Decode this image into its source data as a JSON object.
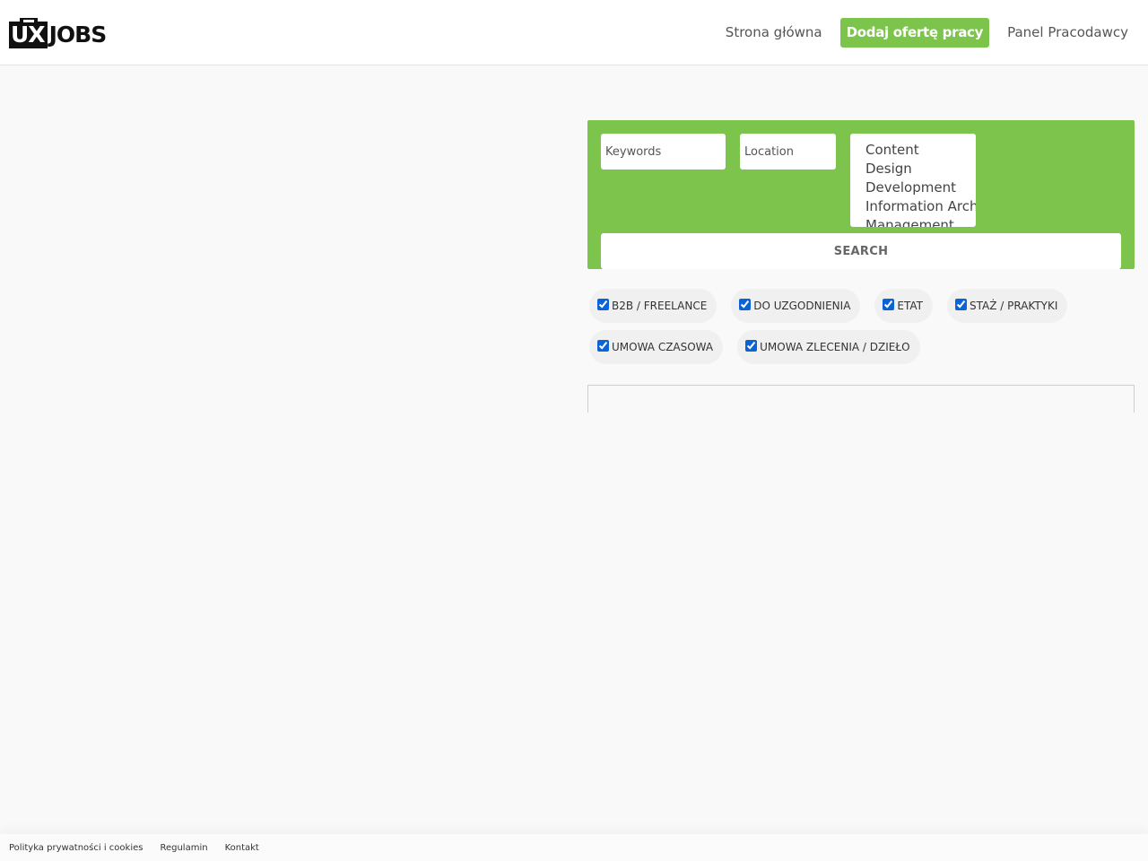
{
  "brand": {
    "logo_box": "UX",
    "logo_text": "JOBS"
  },
  "nav": {
    "items": [
      {
        "label": "Strona główna"
      },
      {
        "label": "Dodaj ofertę pracy"
      },
      {
        "label": "Panel Pracodawcy"
      }
    ],
    "cta_color": "#7cc44c"
  },
  "search": {
    "keywords_placeholder": "Keywords",
    "location_placeholder": "Location",
    "categories": [
      "Content",
      "Design",
      "Development",
      "Information Arch",
      "Management"
    ],
    "button_label": "SEARCH",
    "panel_color": "#7cc44c"
  },
  "filters": {
    "job_types": [
      {
        "label": "B2B / FREELANCE",
        "checked": true
      },
      {
        "label": "DO UZGODNIENIA",
        "checked": true
      },
      {
        "label": "ETAT",
        "checked": true
      },
      {
        "label": "STAŻ / PRAKTYKI",
        "checked": true
      },
      {
        "label": "UMOWA CZASOWA",
        "checked": true
      },
      {
        "label": "UMOWA ZLECENIA / DZIEŁO",
        "checked": true
      }
    ]
  },
  "footer": {
    "links": [
      {
        "label": "Polityka prywatności i cookies"
      },
      {
        "label": "Regulamin"
      },
      {
        "label": "Kontakt"
      }
    ]
  }
}
